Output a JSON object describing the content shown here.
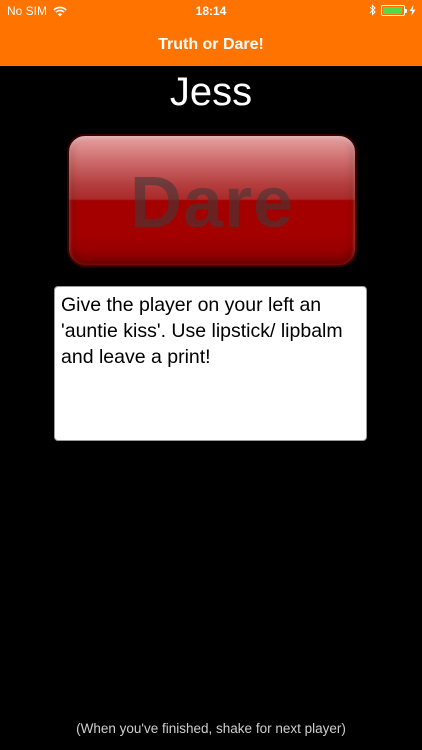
{
  "status_bar": {
    "carrier": "No SIM",
    "time": "18:14",
    "battery_color": "#55d94a"
  },
  "nav": {
    "title": "Truth or Dare!",
    "bar_color": "#ff7300"
  },
  "player": {
    "name": "Jess"
  },
  "dare_button": {
    "label": "Dare"
  },
  "dare_text": "Give the player on your left an 'auntie kiss'. Use lipstick/ lipbalm and leave a print!",
  "footer": {
    "hint": "(When you've finished, shake for next player)"
  }
}
